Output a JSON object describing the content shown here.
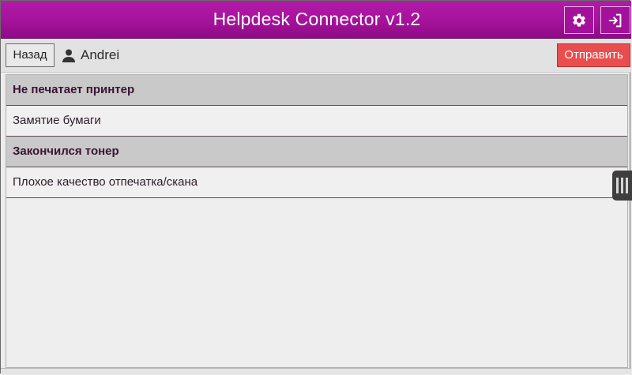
{
  "app": {
    "title": "Helpdesk Connector v1.2",
    "accent_color": "#a5129b",
    "settings_icon": "gear-icon",
    "logout_icon": "sign-out-icon"
  },
  "toolbar": {
    "back_label": "Назад",
    "user_icon": "user-icon",
    "user_name": "Andrei",
    "send_label": "Отправить",
    "send_color": "#ea4d4d"
  },
  "list": {
    "items": [
      {
        "label": "Не печатает принтер",
        "kind": "group"
      },
      {
        "label": "Замятие бумаги",
        "kind": "item"
      },
      {
        "label": "Закончился тонер",
        "kind": "group"
      },
      {
        "label": "Плохое качество отпечатка/скана",
        "kind": "item"
      }
    ]
  },
  "side_handle": {
    "icon": "drag-handle-icon"
  }
}
